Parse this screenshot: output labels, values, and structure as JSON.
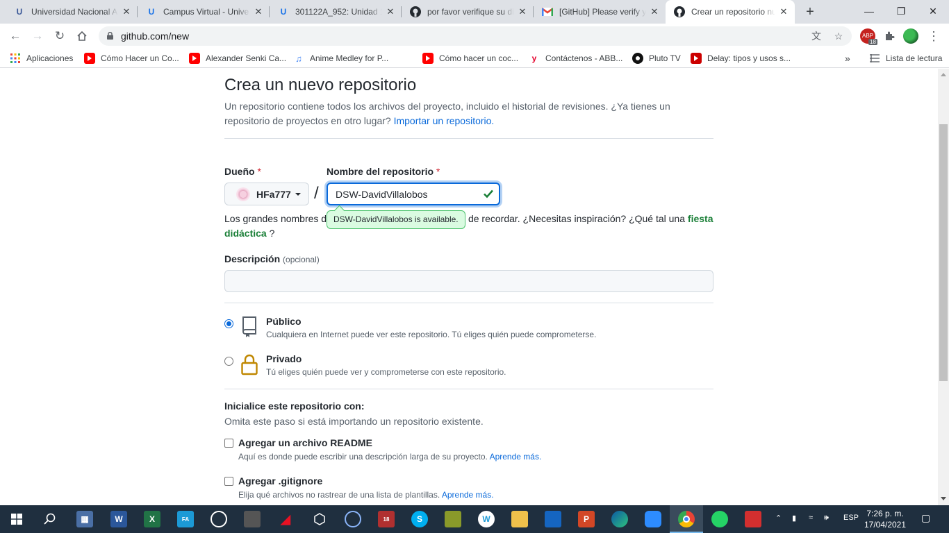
{
  "browser": {
    "tabs": [
      {
        "title": "Universidad Nacional A",
        "favicon": "unad-icon"
      },
      {
        "title": "Campus Virtual - Unive",
        "favicon": "unad-icon"
      },
      {
        "title": "301122A_952: Unidad 1",
        "favicon": "unad-icon"
      },
      {
        "title": "por favor verifique su di",
        "favicon": "github-icon"
      },
      {
        "title": "[GitHub] Please verify y",
        "favicon": "gmail-icon"
      },
      {
        "title": "Crear un repositorio nu",
        "favicon": "github-icon"
      }
    ],
    "url": "github.com/new",
    "bookmarks": [
      "Aplicaciones",
      "Cómo Hacer un Co...",
      "Alexander Senki Ca...",
      "Anime Medley for P...",
      "Cómo hacer un coc...",
      "Contáctenos - ABB...",
      "Pluto TV",
      "Delay: tipos y usos s...",
      "Lista de lectura"
    ],
    "extension_badge": "18"
  },
  "page": {
    "title": "Crea un nuevo repositorio",
    "lead_text": "Un repositorio contiene todos los archivos del proyecto, incluido el historial de revisiones. ¿Ya tienes un repositorio de proyectos en otro lugar?",
    "import_link": "Importar un repositorio.",
    "owner_label": "Dueño",
    "owner_value": "HFa777",
    "repo_label": "Nombre del repositorio",
    "required_mark": "*",
    "slash": "/",
    "repo_value": "DSW-DavidVillalobos",
    "availability_tooltip": "DSW-DavidVillalobos is available.",
    "hint_text_before": "Los grandes nombres de repositorio son cortos y fáciles de recordar. ¿Necesitas inspiración? ¿Qué tal una",
    "hint_suggestion": "fiesta didáctica",
    "hint_text_after": "?",
    "description_label": "Descripción",
    "description_optional": "(opcional)",
    "description_value": "",
    "visibility": [
      {
        "title": "Público",
        "subtitle": "Cualquiera en Internet puede ver este repositorio. Tú eliges quién puede comprometerse.",
        "selected": true
      },
      {
        "title": "Privado",
        "subtitle": "Tú eliges quién puede ver y comprometerse con este repositorio.",
        "selected": false
      }
    ],
    "init_title": "Inicialice este repositorio con:",
    "init_subtitle": "Omita este paso si está importando un repositorio existente.",
    "init_options": [
      {
        "title": "Agregar un archivo README",
        "subtitle": "Aquí es donde puede escribir una descripción larga de su proyecto.",
        "link": "Aprende más.",
        "checked": false
      },
      {
        "title": "Agregar .gitignore",
        "subtitle": "Elija qué archivos no rastrear de una lista de plantillas.",
        "link": "Aprende más.",
        "checked": false
      }
    ]
  },
  "taskbar": {
    "language": "ESP",
    "time": "7:26 p. m.",
    "date": "17/04/2021"
  },
  "colors": {
    "link": "#0969da",
    "success": "#1a7f37",
    "focus": "#0969da",
    "lock_gold": "#bf8700"
  }
}
